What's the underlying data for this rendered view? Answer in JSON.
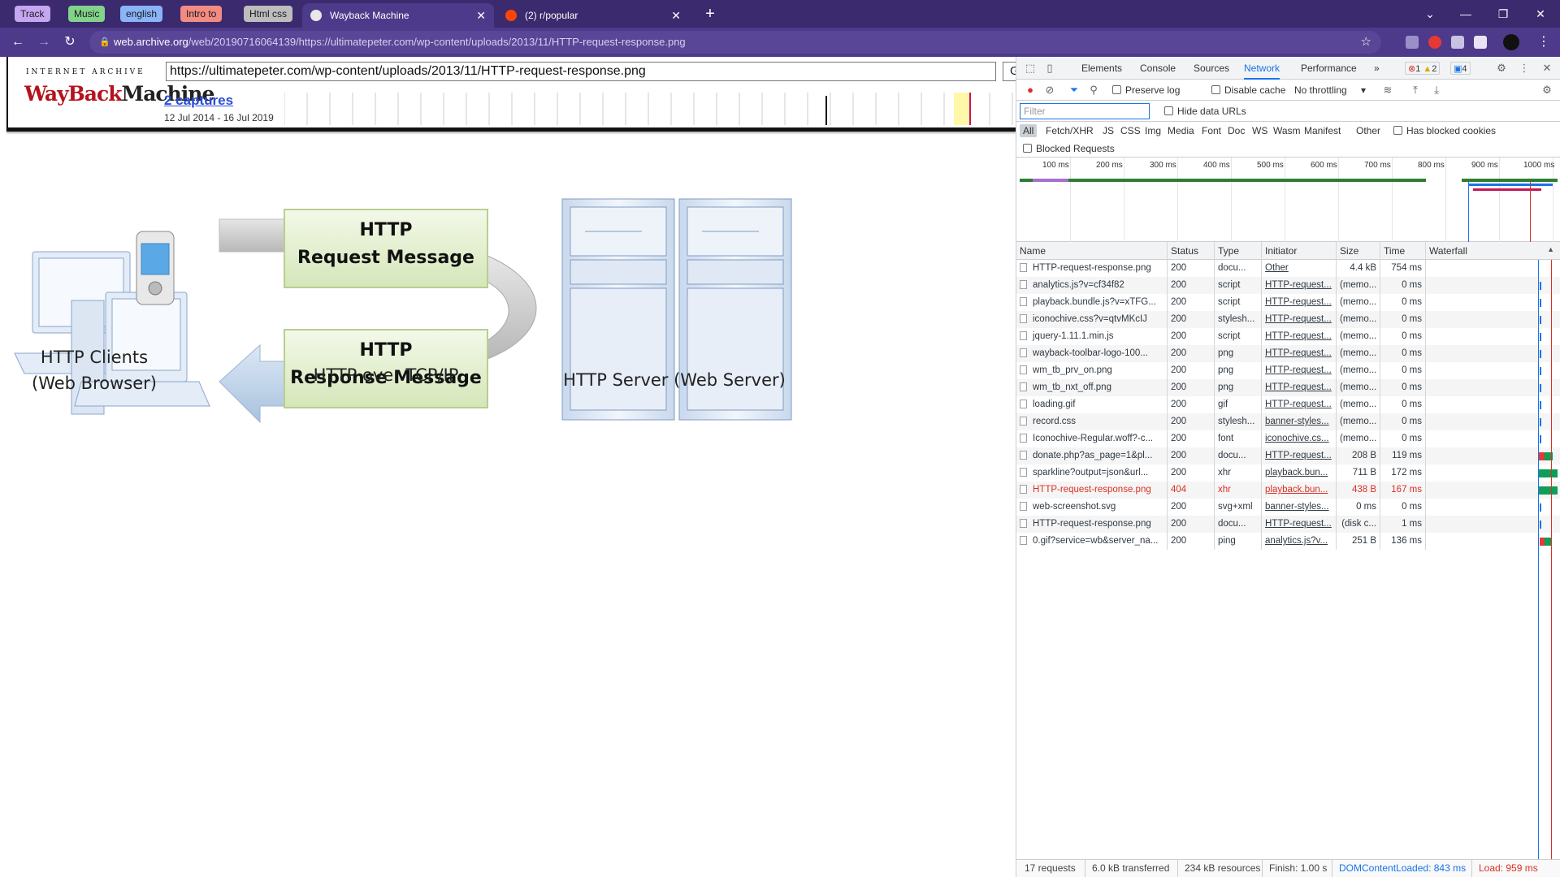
{
  "browser": {
    "pinned_tabs": [
      {
        "label": "Track",
        "color": "#c5a6f0"
      },
      {
        "label": "Music",
        "color": "#82d28a"
      },
      {
        "label": "english",
        "color": "#8ab4f8"
      },
      {
        "label": "Intro to",
        "color": "#f28b82"
      },
      {
        "label": "Html css",
        "color": "#bdbdbd"
      }
    ],
    "tabs": [
      {
        "title": "Wayback Machine",
        "active": true
      },
      {
        "title": "(2) r/popular",
        "active": false
      }
    ],
    "url_host": "web.archive.org",
    "url_rest": "/web/20190716064139/https://ultimatepeter.com/wp-content/uploads/2013/11/HTTP-request-response.png"
  },
  "wayback": {
    "logo_top": "INTERNET ARCHIVE",
    "logo_word1": "WayBack",
    "logo_word2": "Machine",
    "url_value": "https://ultimatepeter.com/wp-content/uploads/2013/11/HTTP-request-response.png",
    "go_label": "Go",
    "captures": "2 captures",
    "date_range": "12 Jul 2014 - 16 Jul 2019"
  },
  "diagram": {
    "request_line1": "HTTP",
    "request_line2": "Request Message",
    "response_line1": "HTTP",
    "response_line2": "Response Message",
    "clients_line1": "HTTP Clients",
    "clients_line2": "(Web Browser)",
    "transport": "HTTP over TCP/IP",
    "server": "HTTP Server (Web Server)"
  },
  "devtools": {
    "tabs": [
      "Elements",
      "Console",
      "Sources",
      "Network",
      "Performance"
    ],
    "active_tab": "Network",
    "more": "»",
    "errors": "1",
    "warnings": "2",
    "messages": "4",
    "preserve_log": "Preserve log",
    "disable_cache": "Disable cache",
    "throttling": "No throttling",
    "filter_placeholder": "Filter",
    "hide_data_urls": "Hide data URLs",
    "filter_types": [
      "All",
      "Fetch/XHR",
      "JS",
      "CSS",
      "Img",
      "Media",
      "Font",
      "Doc",
      "WS",
      "Wasm",
      "Manifest",
      "Other"
    ],
    "has_blocked_cookies": "Has blocked cookies",
    "blocked_requests": "Blocked Requests",
    "overview_ticks": [
      "100 ms",
      "200 ms",
      "300 ms",
      "400 ms",
      "500 ms",
      "600 ms",
      "700 ms",
      "800 ms",
      "900 ms",
      "1000 ms"
    ],
    "columns": [
      "Name",
      "Status",
      "Type",
      "Initiator",
      "Size",
      "Time",
      "Waterfall"
    ],
    "rows": [
      {
        "name": "HTTP-request-response.png",
        "status": "200",
        "type": "docu...",
        "initiator": "Other",
        "size": "4.4 kB",
        "time": "754 ms"
      },
      {
        "name": "analytics.js?v=cf34f82",
        "status": "200",
        "type": "script",
        "initiator": "HTTP-request...",
        "size": "(memo...",
        "time": "0 ms"
      },
      {
        "name": "playback.bundle.js?v=xTFG...",
        "status": "200",
        "type": "script",
        "initiator": "HTTP-request...",
        "size": "(memo...",
        "time": "0 ms"
      },
      {
        "name": "iconochive.css?v=qtvMKcIJ",
        "status": "200",
        "type": "stylesh...",
        "initiator": "HTTP-request...",
        "size": "(memo...",
        "time": "0 ms"
      },
      {
        "name": "jquery-1.11.1.min.js",
        "status": "200",
        "type": "script",
        "initiator": "HTTP-request...",
        "size": "(memo...",
        "time": "0 ms"
      },
      {
        "name": "wayback-toolbar-logo-100...",
        "status": "200",
        "type": "png",
        "initiator": "HTTP-request...",
        "size": "(memo...",
        "time": "0 ms"
      },
      {
        "name": "wm_tb_prv_on.png",
        "status": "200",
        "type": "png",
        "initiator": "HTTP-request...",
        "size": "(memo...",
        "time": "0 ms"
      },
      {
        "name": "wm_tb_nxt_off.png",
        "status": "200",
        "type": "png",
        "initiator": "HTTP-request...",
        "size": "(memo...",
        "time": "0 ms"
      },
      {
        "name": "loading.gif",
        "status": "200",
        "type": "gif",
        "initiator": "HTTP-request...",
        "size": "(memo...",
        "time": "0 ms"
      },
      {
        "name": "record.css",
        "status": "200",
        "type": "stylesh...",
        "initiator": "banner-styles...",
        "size": "(memo...",
        "time": "0 ms"
      },
      {
        "name": "Iconochive-Regular.woff?-c...",
        "status": "200",
        "type": "font",
        "initiator": "iconochive.cs...",
        "size": "(memo...",
        "time": "0 ms"
      },
      {
        "name": "donate.php?as_page=1&pl...",
        "status": "200",
        "type": "docu...",
        "initiator": "HTTP-request...",
        "size": "208 B",
        "time": "119 ms"
      },
      {
        "name": "sparkline?output=json&url...",
        "status": "200",
        "type": "xhr",
        "initiator": "playback.bun...",
        "size": "711 B",
        "time": "172 ms"
      },
      {
        "name": "HTTP-request-response.png",
        "status": "404",
        "type": "xhr",
        "initiator": "playback.bun...",
        "size": "438 B",
        "time": "167 ms",
        "error": true
      },
      {
        "name": "web-screenshot.svg",
        "status": "200",
        "type": "svg+xml",
        "initiator": "banner-styles...",
        "size": "0 ms",
        "time": "0 ms"
      },
      {
        "name": "HTTP-request-response.png",
        "status": "200",
        "type": "docu...",
        "initiator": "HTTP-request...",
        "size": "(disk c...",
        "time": "1 ms"
      },
      {
        "name": "0.gif?service=wb&server_na...",
        "status": "200",
        "type": "ping",
        "initiator": "analytics.js?v...",
        "size": "251 B",
        "time": "136 ms"
      }
    ],
    "status_bar": {
      "requests": "17 requests",
      "transferred": "6.0 kB transferred",
      "resources": "234 kB resources",
      "finish": "Finish: 1.00 s",
      "dom_loaded": "DOMContentLoaded: 843 ms",
      "load": "Load: 959 ms"
    },
    "colors": {
      "accent": "#1a73e8",
      "error": "#d93025",
      "load": "#d93025",
      "dom": "#1a73e8",
      "waterfall_green": "#0f9d58"
    }
  }
}
